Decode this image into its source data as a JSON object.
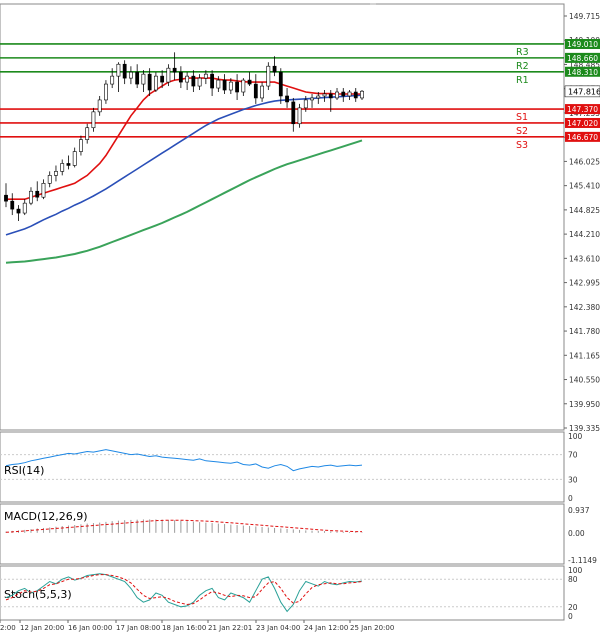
{
  "chart_data": {
    "type": "candlestick",
    "price_scale": {
      "ticks": [
        "149.715",
        "149.100",
        "148.485",
        "147.870",
        "147.255",
        "146.640",
        "146.025",
        "145.410",
        "144.825",
        "144.210",
        "143.610",
        "142.995",
        "142.380",
        "141.780",
        "141.165",
        "140.550",
        "139.950",
        "139.335"
      ],
      "min": 139.335,
      "max": 149.715
    },
    "x_ticks": [
      "2:00",
      "12 Jan 20:00",
      "16 Jan 00:00",
      "17 Jan 08:00",
      "18 Jan 16:00",
      "21 Jan 22:01",
      "23 Jan 04:00",
      "24 Jan 12:00",
      "25 Jan 20:00"
    ],
    "current_price": "147.816",
    "levels": [
      {
        "name": "R3",
        "value": 149.01,
        "label": "149.010",
        "color": "#1c8a1c"
      },
      {
        "name": "R2",
        "value": 148.66,
        "label": "148.660",
        "color": "#1c8a1c"
      },
      {
        "name": "R1",
        "value": 148.31,
        "label": "148.310",
        "color": "#1c8a1c"
      },
      {
        "name": "S1",
        "value": 147.37,
        "label": "147.370",
        "color": "#e01010"
      },
      {
        "name": "S2",
        "value": 147.02,
        "label": "147.020",
        "color": "#e01010"
      },
      {
        "name": "S3",
        "value": 146.67,
        "label": "146.670",
        "color": "#e01010"
      }
    ],
    "candles": [
      [
        145.2,
        145.5,
        144.9,
        145.05
      ],
      [
        145.05,
        145.25,
        144.7,
        144.85
      ],
      [
        144.85,
        144.95,
        144.55,
        144.75
      ],
      [
        144.75,
        145.1,
        144.7,
        145.0
      ],
      [
        145.0,
        145.4,
        144.95,
        145.3
      ],
      [
        145.3,
        145.55,
        145.05,
        145.15
      ],
      [
        145.15,
        145.6,
        145.1,
        145.5
      ],
      [
        145.5,
        145.8,
        145.4,
        145.7
      ],
      [
        145.7,
        145.95,
        145.55,
        145.8
      ],
      [
        145.8,
        146.1,
        145.7,
        146.0
      ],
      [
        146.0,
        146.2,
        145.85,
        145.95
      ],
      [
        145.95,
        146.4,
        145.9,
        146.3
      ],
      [
        146.3,
        146.7,
        146.2,
        146.6
      ],
      [
        146.6,
        147.0,
        146.5,
        146.9
      ],
      [
        146.9,
        147.4,
        146.8,
        147.3
      ],
      [
        147.3,
        147.7,
        147.2,
        147.6
      ],
      [
        147.6,
        148.1,
        147.5,
        148.0
      ],
      [
        148.0,
        148.4,
        147.9,
        148.2
      ],
      [
        148.2,
        148.55,
        147.8,
        148.5
      ],
      [
        148.5,
        148.6,
        148.0,
        148.15
      ],
      [
        148.15,
        148.45,
        148.0,
        148.3
      ],
      [
        148.3,
        148.5,
        147.9,
        148.0
      ],
      [
        148.0,
        148.35,
        147.8,
        148.25
      ],
      [
        148.25,
        148.4,
        147.7,
        147.85
      ],
      [
        147.85,
        148.3,
        147.8,
        148.2
      ],
      [
        148.2,
        148.35,
        147.9,
        148.05
      ],
      [
        148.05,
        148.5,
        147.95,
        148.4
      ],
      [
        148.4,
        148.8,
        148.1,
        148.3
      ],
      [
        148.3,
        148.45,
        147.9,
        148.05
      ],
      [
        148.05,
        148.3,
        147.85,
        148.2
      ],
      [
        148.2,
        148.35,
        147.8,
        147.95
      ],
      [
        147.95,
        148.25,
        147.85,
        148.15
      ],
      [
        148.15,
        148.35,
        148.0,
        148.25
      ],
      [
        148.25,
        148.35,
        147.7,
        147.9
      ],
      [
        147.9,
        148.2,
        147.8,
        148.1
      ],
      [
        148.1,
        148.25,
        147.75,
        147.85
      ],
      [
        147.85,
        148.15,
        147.75,
        148.05
      ],
      [
        148.05,
        148.25,
        147.6,
        147.8
      ],
      [
        147.8,
        148.15,
        147.7,
        148.1
      ],
      [
        148.1,
        148.3,
        147.95,
        148.0
      ],
      [
        148.0,
        148.25,
        147.5,
        147.65
      ],
      [
        147.65,
        148.05,
        147.55,
        147.95
      ],
      [
        147.95,
        148.55,
        147.85,
        148.45
      ],
      [
        148.45,
        148.7,
        148.2,
        148.3
      ],
      [
        148.3,
        148.4,
        147.5,
        147.7
      ],
      [
        147.7,
        147.9,
        147.4,
        147.55
      ],
      [
        147.55,
        147.65,
        146.8,
        147.0
      ],
      [
        147.0,
        147.5,
        146.9,
        147.4
      ],
      [
        147.4,
        147.7,
        147.3,
        147.6
      ],
      [
        147.6,
        147.75,
        147.4,
        147.65
      ],
      [
        147.65,
        147.8,
        147.5,
        147.7
      ],
      [
        147.7,
        147.85,
        147.55,
        147.75
      ],
      [
        147.75,
        147.85,
        147.3,
        147.65
      ],
      [
        147.65,
        147.9,
        147.6,
        147.8
      ],
      [
        147.8,
        147.9,
        147.55,
        147.7
      ],
      [
        147.7,
        147.85,
        147.6,
        147.8
      ],
      [
        147.8,
        147.9,
        147.55,
        147.65
      ],
      [
        147.65,
        147.85,
        147.6,
        147.82
      ]
    ],
    "ma_red": [
      145.1,
      145.1,
      145.1,
      145.1,
      145.15,
      145.2,
      145.25,
      145.3,
      145.35,
      145.4,
      145.45,
      145.5,
      145.6,
      145.7,
      145.85,
      146.0,
      146.2,
      146.45,
      146.7,
      146.95,
      147.2,
      147.4,
      147.6,
      147.75,
      147.85,
      147.95,
      148.05,
      148.1,
      148.12,
      148.15,
      148.15,
      148.15,
      148.15,
      148.15,
      148.12,
      148.1,
      148.1,
      148.08,
      148.06,
      148.05,
      148.05,
      148.05,
      148.05,
      148.05,
      148.0,
      147.95,
      147.9,
      147.85,
      147.8,
      147.78,
      147.76,
      147.76,
      147.76,
      147.75,
      147.75,
      147.75,
      147.75,
      147.75
    ],
    "ma_blue": [
      144.2,
      144.25,
      144.3,
      144.35,
      144.42,
      144.5,
      144.58,
      144.65,
      144.72,
      144.8,
      144.87,
      144.95,
      145.02,
      145.1,
      145.18,
      145.27,
      145.36,
      145.46,
      145.56,
      145.66,
      145.76,
      145.86,
      145.96,
      146.06,
      146.16,
      146.26,
      146.36,
      146.46,
      146.56,
      146.66,
      146.76,
      146.86,
      146.96,
      147.04,
      147.12,
      147.18,
      147.24,
      147.3,
      147.36,
      147.41,
      147.46,
      147.5,
      147.54,
      147.57,
      147.59,
      147.6,
      147.61,
      147.62,
      147.63,
      147.64,
      147.65,
      147.66,
      147.67,
      147.68,
      147.69,
      147.7,
      147.71,
      147.72
    ],
    "ma_green": [
      143.5,
      143.51,
      143.52,
      143.53,
      143.55,
      143.57,
      143.59,
      143.61,
      143.63,
      143.66,
      143.69,
      143.72,
      143.76,
      143.8,
      143.85,
      143.9,
      143.96,
      144.02,
      144.08,
      144.14,
      144.2,
      144.26,
      144.32,
      144.38,
      144.44,
      144.5,
      144.57,
      144.64,
      144.71,
      144.78,
      144.86,
      144.94,
      145.02,
      145.1,
      145.18,
      145.26,
      145.34,
      145.42,
      145.5,
      145.58,
      145.65,
      145.72,
      145.79,
      145.86,
      145.92,
      145.98,
      146.03,
      146.08,
      146.13,
      146.18,
      146.23,
      146.28,
      146.33,
      146.38,
      146.43,
      146.48,
      146.53,
      146.58
    ],
    "rsi": {
      "label": "RSI(14)",
      "ticks": [
        "100",
        "70",
        "30",
        "0"
      ],
      "values": [
        52,
        54,
        55,
        57,
        60,
        62,
        64,
        66,
        68,
        70,
        72,
        71,
        73,
        75,
        74,
        76,
        78,
        76,
        74,
        72,
        70,
        71,
        69,
        67,
        68,
        66,
        65,
        64,
        63,
        62,
        61,
        63,
        60,
        59,
        58,
        57,
        56,
        58,
        54,
        53,
        55,
        50,
        48,
        52,
        54,
        51,
        44,
        47,
        49,
        51,
        50,
        52,
        53,
        51,
        52,
        53,
        52,
        53
      ],
      "min": 0,
      "max": 100
    },
    "macd": {
      "label": "MACD(12,26,9)",
      "ticks": [
        "0.937",
        "0.00",
        "-1.1149"
      ],
      "min": -1.1149,
      "max": 0.937,
      "histogram": [
        0.05,
        0.08,
        0.1,
        0.12,
        0.15,
        0.18,
        0.2,
        0.22,
        0.25,
        0.28,
        0.3,
        0.32,
        0.35,
        0.38,
        0.4,
        0.42,
        0.45,
        0.48,
        0.5,
        0.52,
        0.53,
        0.54,
        0.55,
        0.55,
        0.55,
        0.54,
        0.53,
        0.52,
        0.5,
        0.48,
        0.46,
        0.44,
        0.42,
        0.4,
        0.38,
        0.36,
        0.34,
        0.32,
        0.3,
        0.28,
        0.26,
        0.24,
        0.22,
        0.2,
        0.18,
        0.16,
        0.14,
        0.12,
        0.1,
        0.09,
        0.08,
        0.07,
        0.06,
        0.05,
        0.04,
        0.03,
        0.03,
        0.02
      ],
      "signal": [
        0.02,
        0.04,
        0.06,
        0.08,
        0.1,
        0.12,
        0.14,
        0.16,
        0.18,
        0.2,
        0.22,
        0.24,
        0.26,
        0.28,
        0.3,
        0.32,
        0.34,
        0.36,
        0.38,
        0.4,
        0.42,
        0.44,
        0.46,
        0.48,
        0.5,
        0.51,
        0.52,
        0.52,
        0.52,
        0.51,
        0.5,
        0.49,
        0.48,
        0.47,
        0.45,
        0.43,
        0.41,
        0.39,
        0.37,
        0.35,
        0.33,
        0.31,
        0.29,
        0.27,
        0.25,
        0.23,
        0.21,
        0.19,
        0.17,
        0.15,
        0.13,
        0.11,
        0.09,
        0.08,
        0.07,
        0.06,
        0.05,
        0.05
      ]
    },
    "stoch": {
      "label": "Stoch(5,5,3)",
      "ticks": [
        "100",
        "80",
        "20",
        "0"
      ],
      "min": 0,
      "max": 100,
      "main": [
        40,
        45,
        55,
        60,
        50,
        55,
        65,
        75,
        70,
        80,
        85,
        78,
        82,
        88,
        90,
        92,
        90,
        85,
        80,
        75,
        60,
        40,
        30,
        35,
        50,
        45,
        30,
        25,
        20,
        22,
        30,
        45,
        55,
        60,
        40,
        35,
        50,
        45,
        40,
        30,
        55,
        80,
        85,
        60,
        30,
        10,
        25,
        55,
        75,
        70,
        65,
        75,
        70,
        68,
        72,
        75,
        74,
        76
      ],
      "signal": [
        35,
        40,
        48,
        55,
        52,
        54,
        60,
        68,
        70,
        75,
        80,
        80,
        82,
        85,
        88,
        90,
        90,
        88,
        85,
        80,
        72,
        58,
        45,
        38,
        40,
        42,
        38,
        32,
        28,
        25,
        27,
        35,
        45,
        53,
        50,
        45,
        42,
        45,
        44,
        40,
        42,
        58,
        72,
        75,
        60,
        40,
        28,
        32,
        48,
        62,
        68,
        70,
        72,
        70,
        70,
        72,
        73,
        75
      ]
    },
    "colors": {
      "bull": "#1c8a1c",
      "bear": "#e01010",
      "ma_red": "#e01010",
      "ma_blue": "#2a4fb8",
      "ma_green": "#3aa35a",
      "rsi": "#1e88e5",
      "macd_hist": "#9a9a9a",
      "macd_signal": "#e01010",
      "stoch_main": "#2aa198",
      "stoch_signal": "#e01010"
    }
  }
}
